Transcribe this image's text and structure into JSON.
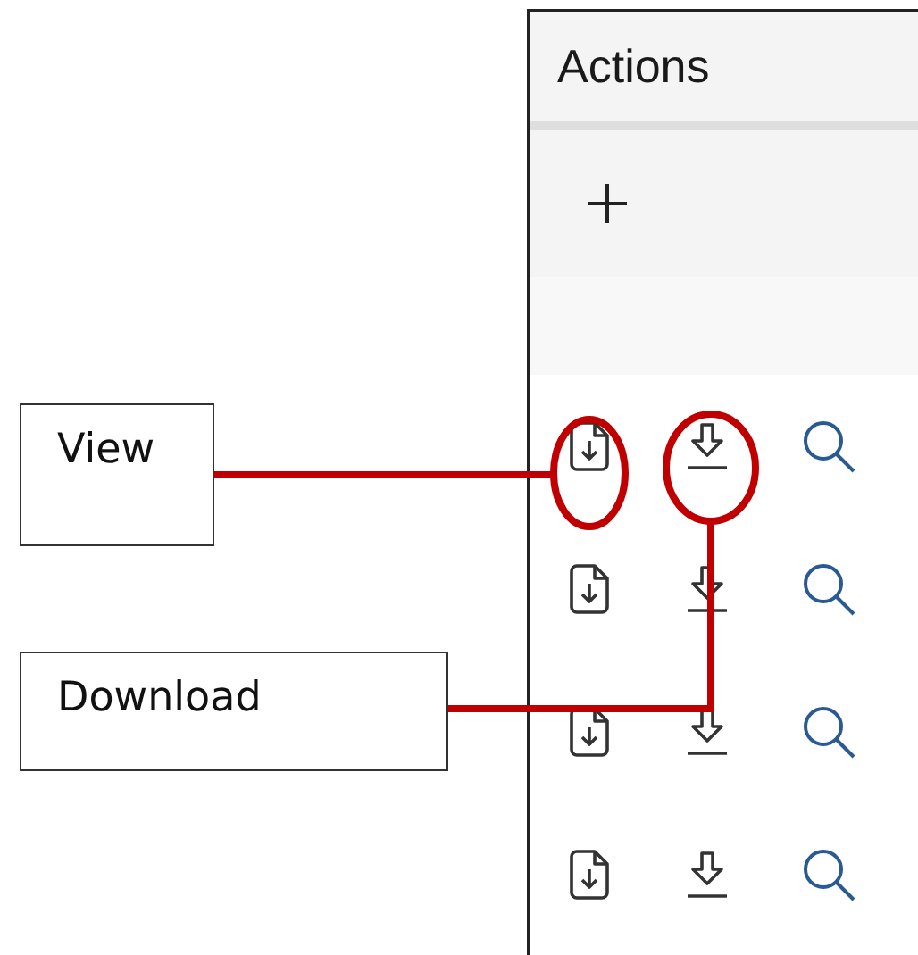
{
  "panel": {
    "title": "Actions",
    "toolbar": {
      "add_action": {
        "kind": "add"
      }
    },
    "rows": [
      {
        "actions": [
          {
            "kind": "view"
          },
          {
            "kind": "download"
          },
          {
            "kind": "search"
          }
        ]
      },
      {
        "actions": [
          {
            "kind": "view"
          },
          {
            "kind": "download"
          },
          {
            "kind": "search"
          }
        ]
      },
      {
        "actions": [
          {
            "kind": "view"
          },
          {
            "kind": "download"
          },
          {
            "kind": "search"
          }
        ]
      },
      {
        "actions": [
          {
            "kind": "view"
          },
          {
            "kind": "download"
          },
          {
            "kind": "search"
          }
        ]
      }
    ]
  },
  "callouts": [
    {
      "kind": "view",
      "label": "View"
    },
    {
      "kind": "download",
      "label": "Download"
    }
  ]
}
